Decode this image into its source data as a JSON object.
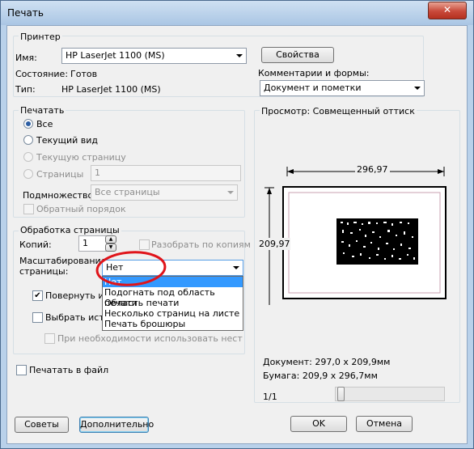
{
  "window": {
    "title": "Печать",
    "close_glyph": "✕"
  },
  "printer": {
    "group_title": "Принтер",
    "name_label": "Имя:",
    "name_value": "HP LaserJet 1100 (MS)",
    "properties_button": "Свойства",
    "status_label": "Состояние:",
    "status_value": "Готов",
    "type_label": "Тип:",
    "type_value": "HP LaserJet 1100 (MS)",
    "comments_label": "Комментарии и формы:",
    "comments_value": "Документ и пометки"
  },
  "print_range": {
    "group_title": "Печатать",
    "options": [
      "Все",
      "Текущий вид",
      "Текущую страницу",
      "Страницы"
    ],
    "pages_value": "1",
    "subset_label": "Подмножество:",
    "subset_value": "Все страницы",
    "reverse_label": "Обратный порядок"
  },
  "page_handling": {
    "group_title": "Обработка страницы",
    "copies_label": "Копий:",
    "copies_value": "1",
    "collate_label": "Разобрать по копиям",
    "scaling_label_1": "Масштабирование",
    "scaling_label_2": "страницы:",
    "scaling_value": "Нет",
    "scaling_options": [
      "Нет",
      "Подогнать под область печати",
      "Область печати",
      "Несколько страниц на листе",
      "Печать брошюры"
    ],
    "rotate_label": "Повернуть и р",
    "choose_source_label": "Выбрать источ",
    "custom_size_label": "При необходимости использовать нест"
  },
  "print_to_file_label": "Печатать в файл",
  "preview": {
    "title": "Просмотр: Совмещенный оттиск",
    "width_label": "296,97",
    "height_label": "209,97",
    "document_info": "Документ: 297,0 x 209,9мм",
    "paper_info": "Бумага: 209,9 x 296,7мм",
    "page_counter": "1/1"
  },
  "buttons": {
    "tips": "Советы",
    "advanced": "Дополнительно",
    "ok": "OK",
    "cancel": "Отмена"
  },
  "colors": {
    "annotation_ellipse": "#e0141a",
    "selection": "#3399ff"
  }
}
